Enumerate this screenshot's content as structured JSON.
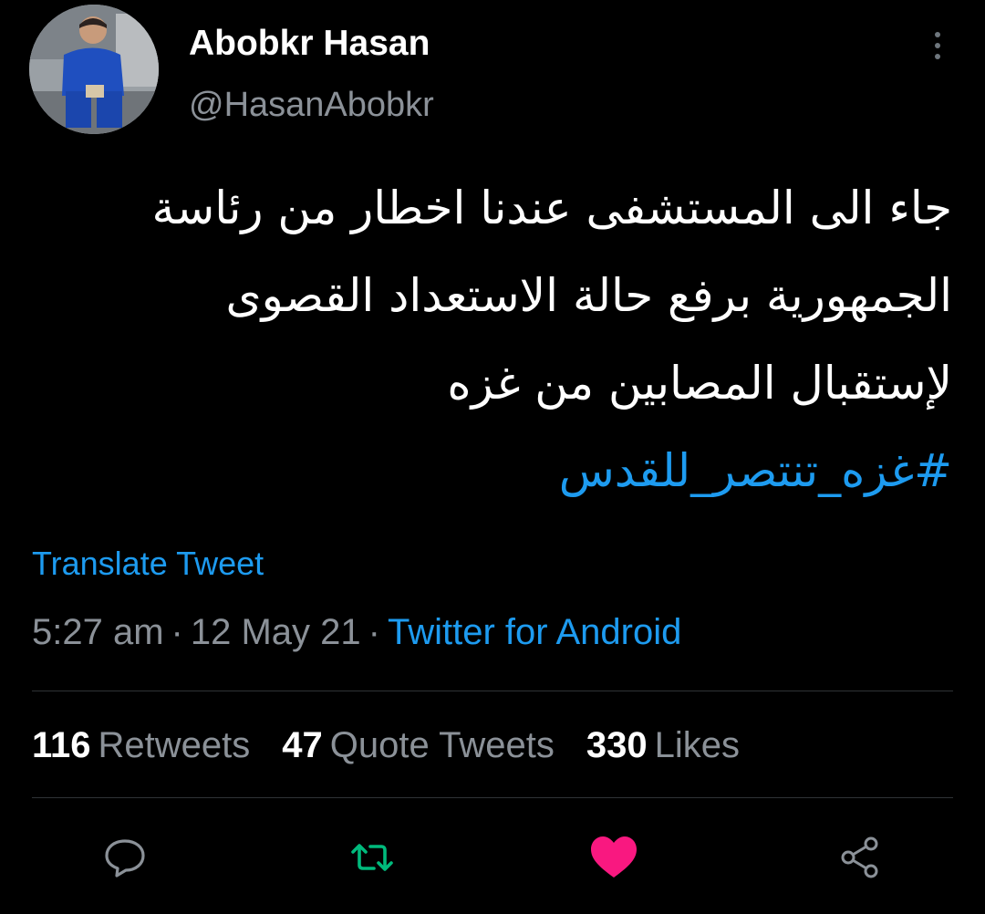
{
  "author": {
    "display_name": "Abobkr Hasan",
    "handle": "@HasanAbobkr"
  },
  "tweet": {
    "text": "جاء الى المستشفى عندنا اخطار من رئاسة\nالجمهورية برفع حالة الاستعداد القصوى\nلإستقبال المصابين من غزه",
    "hashtag": "#غزه_تنتصر_للقدس",
    "translate_label": "Translate Tweet",
    "time": "5:27 am",
    "date": "12 May 21",
    "separator": "·",
    "source": "Twitter for Android"
  },
  "stats": {
    "retweets_count": "116",
    "retweets_label": "Retweets",
    "quotes_count": "47",
    "quotes_label": "Quote Tweets",
    "likes_count": "330",
    "likes_label": "Likes"
  },
  "icons": {
    "more": "more-vertical-icon",
    "reply": "reply-icon",
    "retweet": "retweet-icon",
    "like": "heart-icon",
    "share": "share-icon"
  },
  "colors": {
    "background": "#000000",
    "accent": "#1d9bf0",
    "retweet_active": "#00ba7c",
    "like_active": "#f91880",
    "secondary_text": "#8b9198"
  }
}
